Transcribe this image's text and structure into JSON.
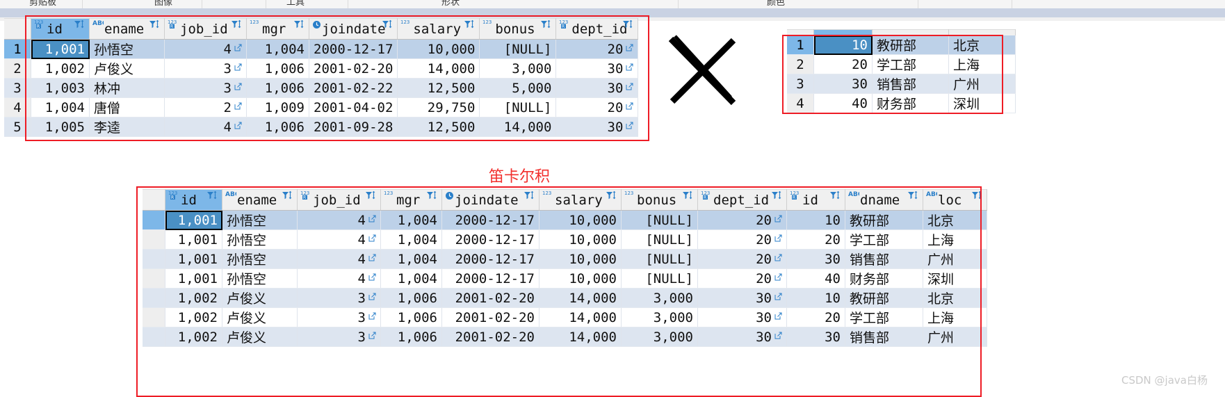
{
  "menu": {
    "items": [
      "剪贴板",
      "图像",
      "工具",
      "形状",
      "颜色"
    ]
  },
  "labels": {
    "cartesian_product": "笛卡尔积",
    "watermark": "CSDN @java白杨",
    "cross_operator": "×"
  },
  "icons": {
    "number_type": "number-type-icon",
    "text_type": "abc-type-icon",
    "date_type": "clock-type-icon",
    "key_type": "key-number-type-icon",
    "filter_sort": "filter-sort-icon",
    "link": "open-link-icon"
  },
  "emp_table": {
    "name": "emp-result-grid",
    "columns": [
      {
        "label": "id",
        "type": "key",
        "align": "num"
      },
      {
        "label": "ename",
        "type": "abc",
        "align": "txt"
      },
      {
        "label": "job_id",
        "type": "key",
        "align": "num"
      },
      {
        "label": "mgr",
        "type": "num",
        "align": "num"
      },
      {
        "label": "joindate",
        "type": "date",
        "align": "num"
      },
      {
        "label": "salary",
        "type": "num",
        "align": "num"
      },
      {
        "label": "bonus",
        "type": "num",
        "align": "num"
      },
      {
        "label": "dept_id",
        "type": "key",
        "align": "num"
      }
    ],
    "rows": [
      {
        "no": "1",
        "id": "1,001",
        "ename": "孙悟空",
        "job_id": "4",
        "mgr": "1,004",
        "joindate": "2000-12-17",
        "salary": "10,000",
        "bonus": "[NULL]",
        "dept_id": "20"
      },
      {
        "no": "2",
        "id": "1,002",
        "ename": "卢俊义",
        "job_id": "3",
        "mgr": "1,006",
        "joindate": "2001-02-20",
        "salary": "14,000",
        "bonus": "3,000",
        "dept_id": "30"
      },
      {
        "no": "3",
        "id": "1,003",
        "ename": "林冲",
        "job_id": "3",
        "mgr": "1,006",
        "joindate": "2001-02-22",
        "salary": "12,500",
        "bonus": "5,000",
        "dept_id": "30"
      },
      {
        "no": "4",
        "id": "1,004",
        "ename": "唐僧",
        "job_id": "2",
        "mgr": "1,009",
        "joindate": "2001-04-02",
        "salary": "29,750",
        "bonus": "[NULL]",
        "dept_id": "20"
      },
      {
        "no": "5",
        "id": "1,005",
        "ename": "李逵",
        "job_id": "4",
        "mgr": "1,006",
        "joindate": "2001-09-28",
        "salary": "12,500",
        "bonus": "14,000",
        "dept_id": "30"
      }
    ]
  },
  "dept_table": {
    "name": "dept-result-grid",
    "rows": [
      {
        "no": "1",
        "id": "10",
        "dname": "教研部",
        "loc": "北京"
      },
      {
        "no": "2",
        "id": "20",
        "dname": "学工部",
        "loc": "上海"
      },
      {
        "no": "3",
        "id": "30",
        "dname": "销售部",
        "loc": "广州"
      },
      {
        "no": "4",
        "id": "40",
        "dname": "财务部",
        "loc": "深圳"
      }
    ]
  },
  "join_table": {
    "name": "cartesian-result-grid",
    "columns": [
      {
        "label": "id",
        "type": "key",
        "align": "num"
      },
      {
        "label": "ename",
        "type": "abc",
        "align": "txt"
      },
      {
        "label": "job_id",
        "type": "key",
        "align": "num"
      },
      {
        "label": "mgr",
        "type": "num",
        "align": "num"
      },
      {
        "label": "joindate",
        "type": "date",
        "align": "num"
      },
      {
        "label": "salary",
        "type": "num",
        "align": "num"
      },
      {
        "label": "bonus",
        "type": "num",
        "align": "num"
      },
      {
        "label": "dept_id",
        "type": "key",
        "align": "num"
      },
      {
        "label": "id",
        "type": "key",
        "align": "num"
      },
      {
        "label": "dname",
        "type": "abc",
        "align": "txt"
      },
      {
        "label": "loc",
        "type": "abc",
        "align": "txt"
      }
    ],
    "rows": [
      {
        "id": "1,001",
        "ename": "孙悟空",
        "job_id": "4",
        "mgr": "1,004",
        "joindate": "2000-12-17",
        "salary": "10,000",
        "bonus": "[NULL]",
        "dept_id": "20",
        "did": "10",
        "dname": "教研部",
        "loc": "北京"
      },
      {
        "id": "1,001",
        "ename": "孙悟空",
        "job_id": "4",
        "mgr": "1,004",
        "joindate": "2000-12-17",
        "salary": "10,000",
        "bonus": "[NULL]",
        "dept_id": "20",
        "did": "20",
        "dname": "学工部",
        "loc": "上海"
      },
      {
        "id": "1,001",
        "ename": "孙悟空",
        "job_id": "4",
        "mgr": "1,004",
        "joindate": "2000-12-17",
        "salary": "10,000",
        "bonus": "[NULL]",
        "dept_id": "20",
        "did": "30",
        "dname": "销售部",
        "loc": "广州"
      },
      {
        "id": "1,001",
        "ename": "孙悟空",
        "job_id": "4",
        "mgr": "1,004",
        "joindate": "2000-12-17",
        "salary": "10,000",
        "bonus": "[NULL]",
        "dept_id": "20",
        "did": "40",
        "dname": "财务部",
        "loc": "深圳"
      },
      {
        "id": "1,002",
        "ename": "卢俊义",
        "job_id": "3",
        "mgr": "1,006",
        "joindate": "2001-02-20",
        "salary": "14,000",
        "bonus": "3,000",
        "dept_id": "30",
        "did": "10",
        "dname": "教研部",
        "loc": "北京"
      },
      {
        "id": "1,002",
        "ename": "卢俊义",
        "job_id": "3",
        "mgr": "1,006",
        "joindate": "2001-02-20",
        "salary": "14,000",
        "bonus": "3,000",
        "dept_id": "30",
        "did": "20",
        "dname": "学工部",
        "loc": "上海"
      },
      {
        "id": "1,002",
        "ename": "卢俊义",
        "job_id": "3",
        "mgr": "1,006",
        "joindate": "2001-02-20",
        "salary": "14,000",
        "bonus": "3,000",
        "dept_id": "30",
        "did": "30",
        "dname": "销售部",
        "loc": "广州"
      }
    ]
  },
  "colors": {
    "accent_red": "#ee1c25",
    "header_sel": "#7db7e8",
    "row_alt": "#dde5f0",
    "row_hl": "#bdd1e8",
    "null_text": "#a8a8a8",
    "link_blue": "#2a7fc9"
  }
}
